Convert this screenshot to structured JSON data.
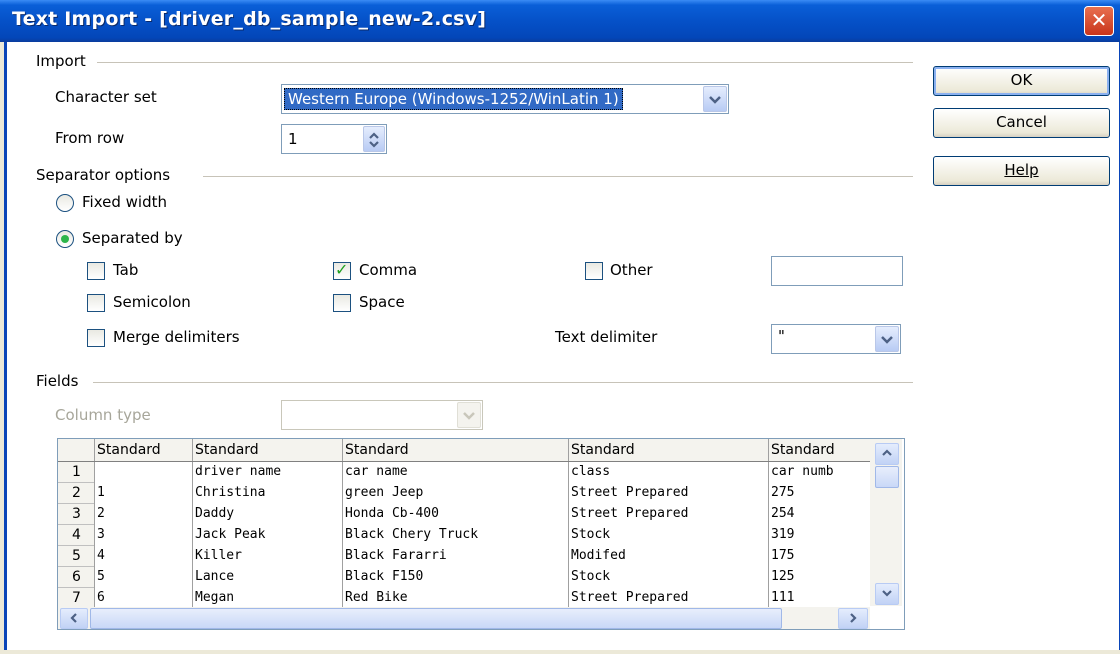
{
  "window": {
    "title": "Text Import - [driver_db_sample_new-2.csv]",
    "close_glyph": "✕"
  },
  "buttons": {
    "ok": "OK",
    "cancel": "Cancel",
    "help": "Help"
  },
  "import_section": {
    "heading": "Import",
    "charset_label": "Character set",
    "charset_value": "Western Europe (Windows-1252/WinLatin 1)",
    "from_row_label": "From row",
    "from_row_value": "1"
  },
  "separator_section": {
    "heading": "Separator options",
    "fixed_width": "Fixed width",
    "separated_by": "Separated by",
    "options": {
      "tab": "Tab",
      "comma": "Comma",
      "other": "Other",
      "semicolon": "Semicolon",
      "space": "Space",
      "merge": "Merge delimiters"
    },
    "checked": {
      "tab": false,
      "comma": true,
      "other": false,
      "semicolon": false,
      "space": false,
      "merge": false
    },
    "selected_mode": "separated_by",
    "text_delimiter_label": "Text delimiter",
    "text_delimiter_value": "\""
  },
  "fields_section": {
    "heading": "Fields",
    "column_type_label": "Column type",
    "column_headers": [
      "Standard",
      "Standard",
      "Standard",
      "Standard",
      "Standard"
    ],
    "row_numbers": [
      "1",
      "2",
      "3",
      "4",
      "5",
      "6",
      "7"
    ],
    "rows": [
      [
        "",
        "driver name",
        "car name",
        "class",
        "car numb"
      ],
      [
        "1",
        "Christina",
        "green Jeep",
        "Street Prepared",
        "275"
      ],
      [
        "2",
        "Daddy",
        "Honda Cb-400",
        "Street Prepared",
        "254"
      ],
      [
        "3",
        "Jack Peak",
        "Black Chery Truck",
        "Stock",
        "319"
      ],
      [
        "4",
        "Killer",
        "Black Fararri",
        "Modifed",
        "175"
      ],
      [
        "5",
        "Lance",
        "Black F150",
        "Stock",
        "125"
      ],
      [
        "6",
        "Megan",
        "Red Bike",
        "Street Prepared",
        "111"
      ]
    ]
  },
  "icons": {
    "dropdown": "chevron-down-icon",
    "spin": "spin-updown-icon",
    "scroll_up": "arrow-up-icon",
    "scroll_down": "arrow-down-icon",
    "scroll_left": "arrow-left-icon",
    "scroll_right": "arrow-right-icon"
  },
  "colors": {
    "titlebar": "#0551c8",
    "window_bg": "#ffffff",
    "border": "#0a45b8",
    "check": "#21a121"
  }
}
